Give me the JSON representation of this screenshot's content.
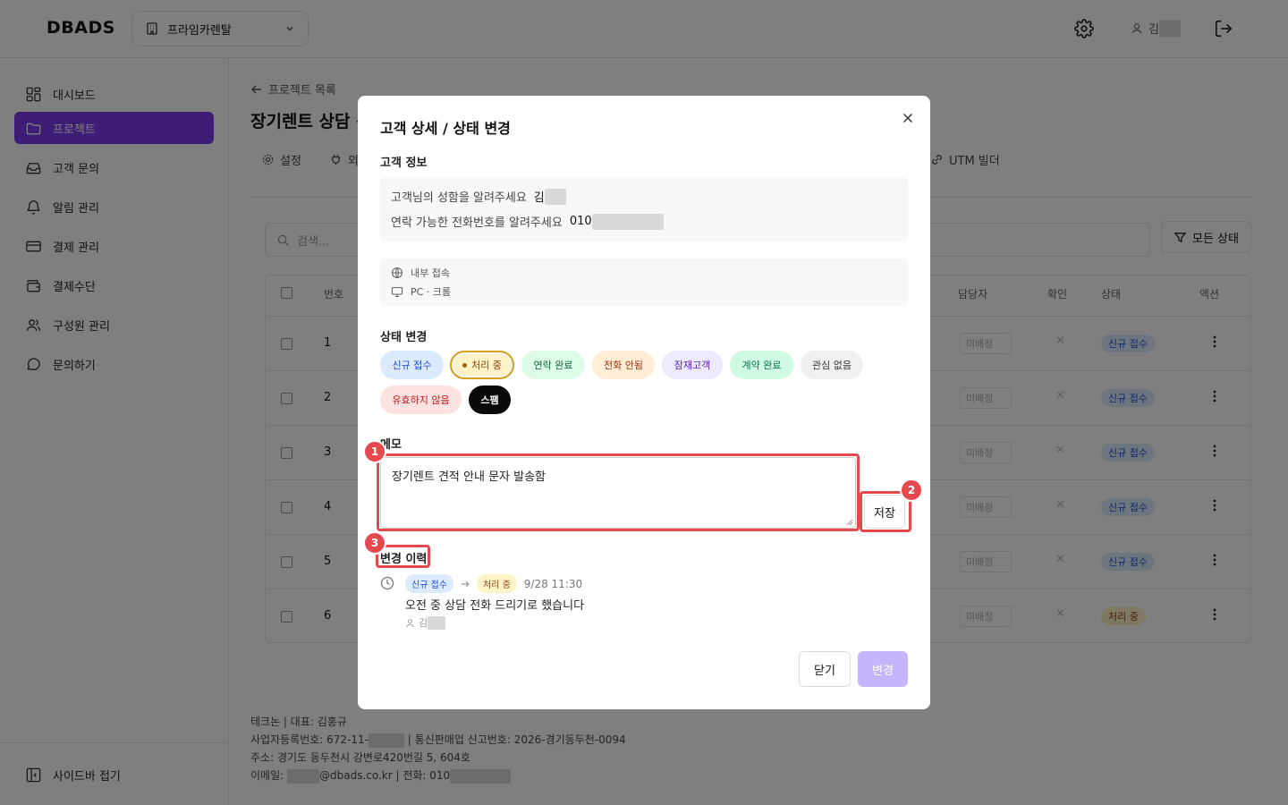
{
  "app": {
    "logo": "DBADS",
    "project_select": "프라임카렌탈",
    "user_initial": "김"
  },
  "sidebar": {
    "items": [
      {
        "label": "대시보드",
        "icon": "dashboard-icon"
      },
      {
        "label": "프로젝트",
        "icon": "folder-icon",
        "active": true
      },
      {
        "label": "고객 문의",
        "icon": "inbox-icon"
      },
      {
        "label": "알림 관리",
        "icon": "bell-icon"
      },
      {
        "label": "결제 관리",
        "icon": "card-icon"
      },
      {
        "label": "결제수단",
        "icon": "wallet-icon"
      },
      {
        "label": "구성원 관리",
        "icon": "users-icon"
      },
      {
        "label": "문의하기",
        "icon": "chat-icon"
      }
    ],
    "collapse_label": "사이드바 접기"
  },
  "main": {
    "back_label": "프로젝트 목록",
    "page_title": "장기렌트 상담 신",
    "tabs": {
      "settings": "설정",
      "second": "외",
      "utm": "UTM 빌더"
    },
    "search_placeholder": "검색...",
    "filter_label": "모든 상태",
    "columns": {
      "number": "번호",
      "assignee": "담당자",
      "check": "확인",
      "status": "상태",
      "action": "액션"
    },
    "rows": [
      {
        "num": "1",
        "assignee": "미배정",
        "status": "신규 접수",
        "status_kind": "new"
      },
      {
        "num": "2",
        "assignee": "미배정",
        "status": "신규 접수",
        "status_kind": "new"
      },
      {
        "num": "3",
        "assignee": "미배정",
        "status": "신규 접수",
        "status_kind": "new"
      },
      {
        "num": "4",
        "assignee": "미배정",
        "status": "신규 접수",
        "status_kind": "new"
      },
      {
        "num": "5",
        "assignee": "미배정",
        "status": "신규 접수",
        "status_kind": "new"
      },
      {
        "num": "6",
        "assignee": "미배정",
        "status": "처리 중",
        "status_kind": "proc"
      }
    ],
    "footer": {
      "company": "테크논 | 대표: 김홍규",
      "biz_prefix": "사업자등록번호: 672-11-",
      "biz_suffix": " | 통신판매업 신고번호: 2026-경기동두천-0094",
      "address": "주소: 경기도 동두천시 강변로420번길 5, 604호",
      "email_prefix": "이메일: ",
      "email_suffix": "@dbads.co.kr | 전화: 010"
    }
  },
  "modal": {
    "title": "고객 상세 / 상태 변경",
    "info_section": "고객 정보",
    "name_question": "고객님의 성함을 알려주세요",
    "name_answer": "김",
    "phone_question": "연락 가능한 전화번호를 알려주세요",
    "phone_answer": "010",
    "env_access": "내부 접속",
    "env_device": "PC · 크롬",
    "status_section": "상태 변경",
    "status_chips": [
      "신규 접수",
      "처리 중",
      "연락 완료",
      "전화 안됨",
      "잠재고객",
      "계약 완료",
      "관심 없음",
      "유효하지 않음",
      "스팸"
    ],
    "selected_status": "처리 중",
    "memo_section": "메모",
    "memo_value": "장기렌트 견적 안내 문자 발송함",
    "save_label": "저장",
    "history_section": "변경 이력",
    "history": {
      "from": "신규 접수",
      "to": "처리 중",
      "time": "9/28 11:30",
      "note": "오전 중 상담 전화 드리기로 했습니다",
      "user": "김"
    },
    "close_label": "닫기",
    "change_label": "변경",
    "callouts": [
      "1",
      "2",
      "3"
    ]
  },
  "colors": {
    "accent": "#7c3aed",
    "accent_disabled": "#c4b5fd",
    "highlight": "#e5484d"
  }
}
